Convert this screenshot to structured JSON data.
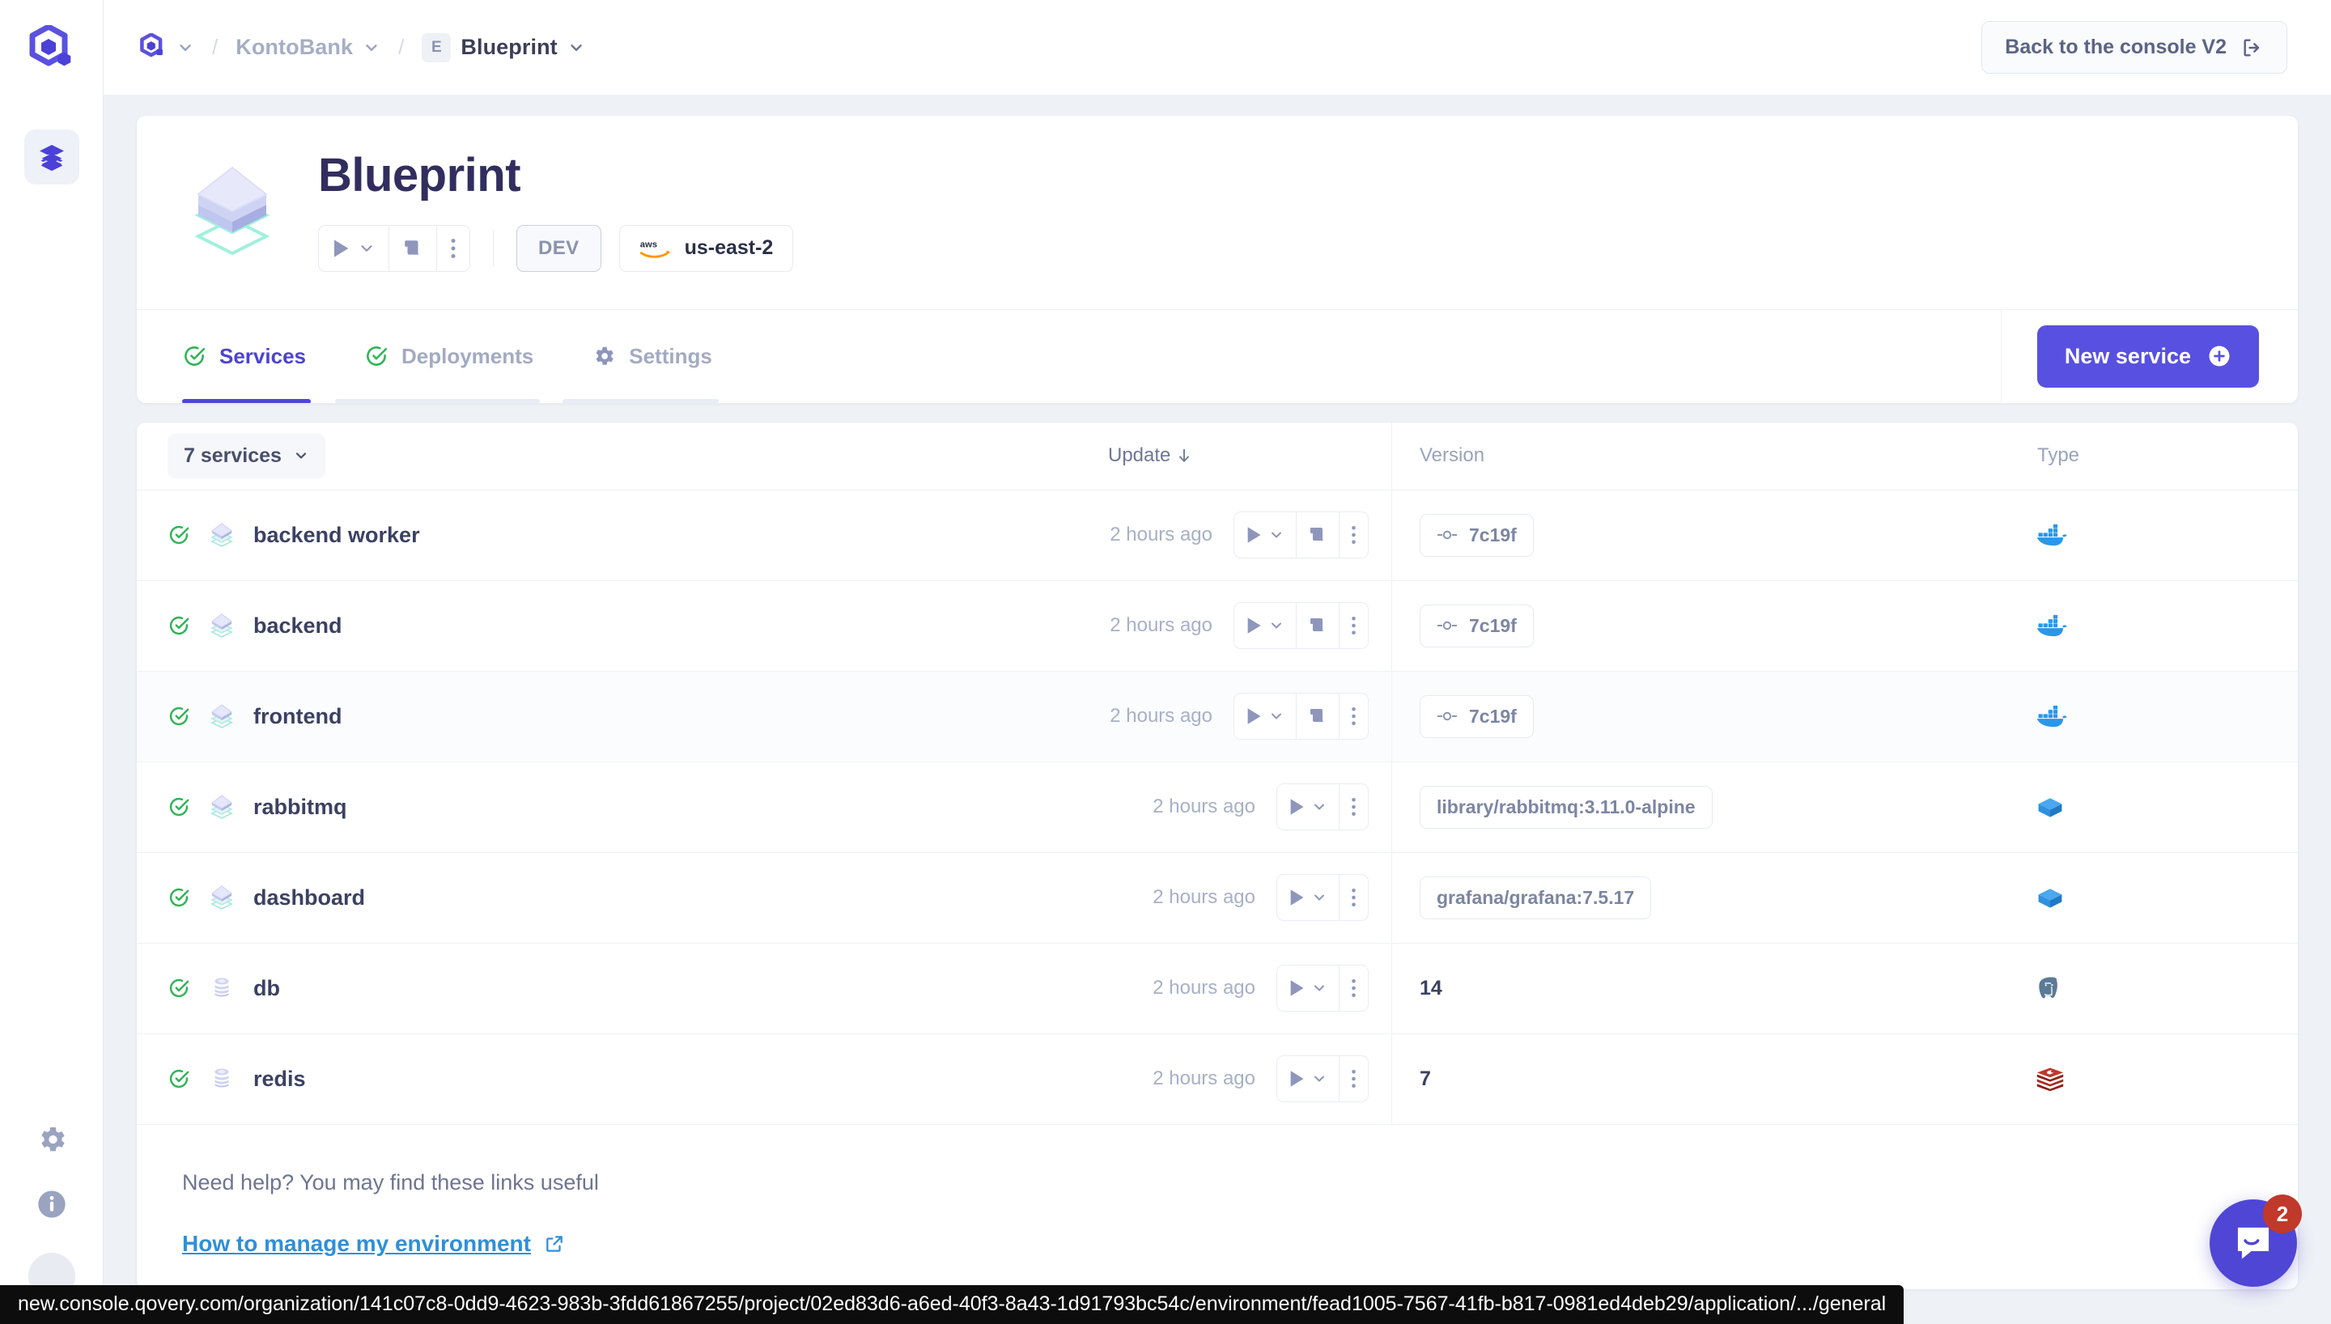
{
  "topbar": {
    "breadcrumb": [
      {
        "label": "",
        "icon": "qovery-logo-icon",
        "has_chevron": true
      },
      {
        "label": "KontoBank",
        "has_chevron": true
      },
      {
        "label": "Blueprint",
        "badge": "E",
        "has_chevron": true
      }
    ],
    "separator": "/",
    "back_button": "Back to the console V2"
  },
  "sidebar": {
    "logo": "qovery-logo-icon",
    "items": [
      {
        "name": "environments",
        "icon": "layers-icon",
        "active": true
      }
    ],
    "bottom": [
      {
        "name": "settings",
        "icon": "gear-icon"
      },
      {
        "name": "info",
        "icon": "info-icon"
      },
      {
        "name": "avatar",
        "icon": "avatar-icon"
      }
    ]
  },
  "header": {
    "title": "Blueprint",
    "icon": "environment-icon",
    "actions": [
      {
        "name": "play",
        "icon": "play-icon"
      },
      {
        "name": "play-dropdown",
        "icon": "chevron-down-icon"
      },
      {
        "name": "logs",
        "icon": "logs-icon"
      },
      {
        "name": "more",
        "icon": "dots-vertical-icon"
      }
    ],
    "mode_badge": "DEV",
    "cloud_provider_icon": "aws-icon",
    "region": "us-east-2"
  },
  "tabs": [
    {
      "label": "Services",
      "icon": "check-circle-icon",
      "active": true
    },
    {
      "label": "Deployments",
      "icon": "check-circle-icon",
      "active": false
    },
    {
      "label": "Settings",
      "icon": "gear-icon",
      "active": false
    }
  ],
  "new_service_button": "New service",
  "table": {
    "count_chip": "7 services",
    "columns": [
      "",
      "Update",
      "Version",
      "Type"
    ],
    "sort_column": "Update",
    "sort_direction": "desc",
    "rows": [
      {
        "status": "healthy",
        "icon": "application-icon",
        "name": "backend worker",
        "updated": "2 hours ago",
        "actions": [
          "play-icon",
          "chevron-down-icon",
          "logs-icon",
          "dots-vertical-icon"
        ],
        "version": "7c19f",
        "version_style": "tag-commit",
        "type_icon": "docker-icon"
      },
      {
        "status": "healthy",
        "icon": "application-icon",
        "name": "backend",
        "updated": "2 hours ago",
        "actions": [
          "play-icon",
          "chevron-down-icon",
          "logs-icon",
          "dots-vertical-icon"
        ],
        "version": "7c19f",
        "version_style": "tag-commit",
        "type_icon": "docker-icon"
      },
      {
        "status": "healthy",
        "icon": "application-icon",
        "name": "frontend",
        "updated": "2 hours ago",
        "actions": [
          "play-icon",
          "chevron-down-icon",
          "logs-icon",
          "dots-vertical-icon"
        ],
        "version": "7c19f",
        "version_style": "tag-commit",
        "type_icon": "docker-icon"
      },
      {
        "status": "healthy",
        "icon": "application-icon",
        "name": "rabbitmq",
        "updated": "2 hours ago",
        "actions": [
          "play-icon",
          "chevron-down-icon",
          "dots-vertical-icon"
        ],
        "version": "library/rabbitmq:3.11.0-alpine",
        "version_style": "tag-plain",
        "type_icon": "container-icon"
      },
      {
        "status": "healthy",
        "icon": "application-icon",
        "name": "dashboard",
        "updated": "2 hours ago",
        "actions": [
          "play-icon",
          "chevron-down-icon",
          "dots-vertical-icon"
        ],
        "version": "grafana/grafana:7.5.17",
        "version_style": "tag-plain",
        "type_icon": "container-icon"
      },
      {
        "status": "healthy",
        "icon": "database-icon",
        "name": "db",
        "updated": "2 hours ago",
        "actions": [
          "play-icon",
          "chevron-down-icon",
          "dots-vertical-icon"
        ],
        "version": "14",
        "version_style": "text",
        "type_icon": "postgresql-icon"
      },
      {
        "status": "healthy",
        "icon": "database-icon",
        "name": "redis",
        "updated": "2 hours ago",
        "actions": [
          "play-icon",
          "chevron-down-icon",
          "dots-vertical-icon"
        ],
        "version": "7",
        "version_style": "text",
        "type_icon": "redis-icon"
      }
    ]
  },
  "help": {
    "title": "Need help? You may find these links useful",
    "link": "How to manage my environment"
  },
  "intercom": {
    "badge_count": "2",
    "icon": "chat-icon"
  },
  "status_bar": {
    "url": "new.console.qovery.com/organization/141c07c8-0dd9-4623-983b-3fdd61867255/project/02ed83d6-a6ed-40f3-8a43-1d91793bc54c/environment/fead1005-7567-41fb-b817-0981ed4deb29/application/.../general"
  },
  "colors": {
    "brand_purple": "#5850e0",
    "accent_purple": "#4f46d6",
    "status_green": "#2fb457",
    "link_blue": "#2f8fd8",
    "docker_blue": "#2a97e8",
    "redis_red": "#a82c22",
    "badge_red": "#c0392b",
    "title_navy": "#312e5f"
  }
}
